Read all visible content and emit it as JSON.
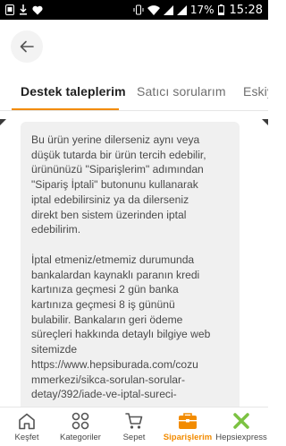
{
  "status_bar": {
    "time": "15:28",
    "battery": "17%"
  },
  "header": {
    "back_icon": "arrow-left-icon"
  },
  "tabs": [
    {
      "label": "Destek taleplerim",
      "active": true
    },
    {
      "label": "Satıcı sorularım",
      "active": false
    },
    {
      "label": "Eskiy",
      "active": false
    }
  ],
  "message": {
    "paragraph_1": [
      "Bu ürün yerine dilerseniz aynı veya",
      "düşük tutarda bir ürün tercih edebilir,",
      "ürününüzü \"Siparişlerim\" adımından",
      "\"Sipariş İptali\" butonunu kullanarak",
      "iptal edebilirsiniz ya da dilerseniz",
      "direkt ben sistem üzerinden iptal",
      "edebilirim."
    ],
    "paragraph_2": [
      "İptal etmeniz/etmemiz durumunda",
      "bankalardan kaynaklı paranın kredi",
      "kartınıza geçmesi 2 gün banka",
      "kartınıza geçmesi 8 iş gününü",
      "bulabilir. Bankaların geri ödeme",
      "süreçleri hakkında detaylı bilgiye web",
      "sitemizde",
      "https://www.hepsiburada.com/cozu",
      "mmerkezi/sikca-sorulan-sorular-",
      "detay/392/iade-ve-iptal-sureci-"
    ]
  },
  "bottom_nav": [
    {
      "label": "Keşfet",
      "icon": "home-icon",
      "active": false
    },
    {
      "label": "Kategoriler",
      "icon": "categories-icon",
      "active": false
    },
    {
      "label": "Sepet",
      "icon": "cart-icon",
      "active": false
    },
    {
      "label": "Siparişlerim",
      "icon": "orders-icon",
      "active": true
    },
    {
      "label": "Hepsiexpress",
      "icon": "hepsiexpress-icon",
      "active": false
    }
  ],
  "colors": {
    "accent": "#f28b00",
    "bubble_bg": "#f0f0f0",
    "hepsiexpress_green": "#7cc242"
  }
}
